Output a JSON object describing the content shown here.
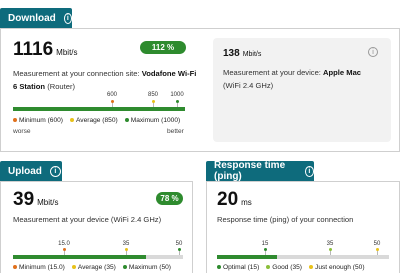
{
  "download": {
    "tab": "Download",
    "value": "1116",
    "unit": "Mbit/s",
    "badge": "112 %",
    "site_prefix": "Measurement at your connection site: ",
    "site_name": "Vodafone Wi-Fi",
    "site_line2_name": "6 Station",
    "site_line2_suffix": " (Router)",
    "fill_fraction": 1.0,
    "ticks": [
      "600",
      "850",
      "1000"
    ],
    "legend": [
      {
        "label": "Minimum",
        "value": "(600)",
        "color": "#e0701c"
      },
      {
        "label": "Average",
        "value": "(850)",
        "color": "#e8c21a"
      },
      {
        "label": "Maximum",
        "value": "(1000)",
        "color": "#2e8b2e"
      }
    ],
    "worse": "worse",
    "better": "better",
    "device": {
      "value": "138",
      "unit": "Mbit/s",
      "prefix": "Measurement at your device: ",
      "name": "Apple Mac",
      "wifi": "(WiFi 2.4 GHz)"
    }
  },
  "upload": {
    "tab": "Upload",
    "value": "39",
    "unit": "Mbit/s",
    "badge": "78 %",
    "caption": "Measurement at your device (WiFi 2.4 GHz)",
    "fill_fraction": 0.78,
    "ticks": [
      "15.0",
      "35",
      "50"
    ],
    "legend": [
      {
        "label": "Minimum",
        "value": "(15.0)",
        "color": "#e0701c"
      },
      {
        "label": "Average",
        "value": "(35)",
        "color": "#e8c21a"
      },
      {
        "label": "Maximum",
        "value": "(50)",
        "color": "#2e8b2e"
      }
    ]
  },
  "ping": {
    "tab": "Response time (ping)",
    "value": "20",
    "unit": "ms",
    "caption": "Response time (ping) of your connection",
    "ticks": [
      "15",
      "35",
      "50"
    ],
    "legend": [
      {
        "label": "Optimal",
        "value": "(15)",
        "color": "#2e8b2e"
      },
      {
        "label": "Good",
        "value": "(35)",
        "color": "#8bbf3a"
      },
      {
        "label": "Just enough",
        "value": "(50)",
        "color": "#e8c21a"
      }
    ]
  }
}
